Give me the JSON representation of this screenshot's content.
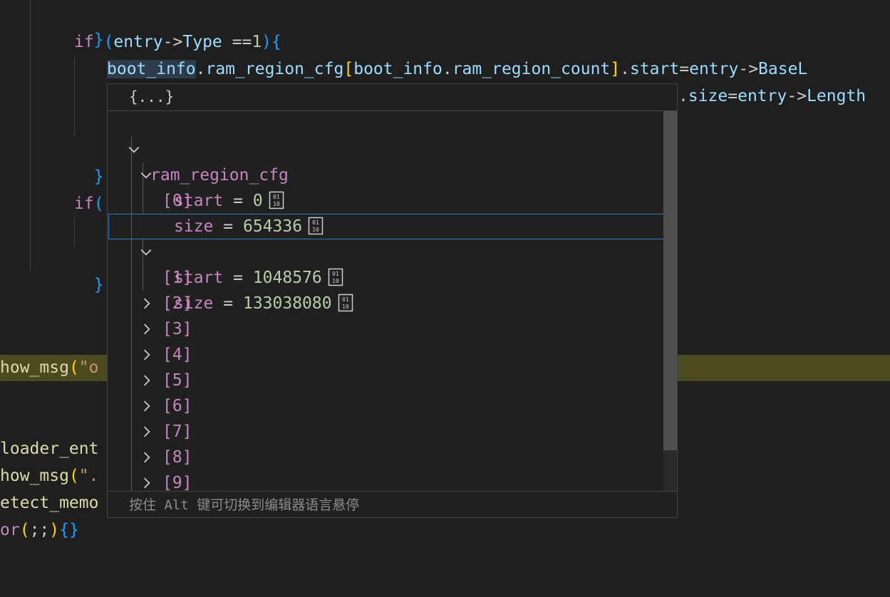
{
  "editor": {
    "lines": {
      "l1_brace": "}",
      "l2_if": "if",
      "l2_open": "(",
      "l2_entry": "entry",
      "l2_arrow": "->",
      "l2_type": "Type",
      "l2_eqeq": " ==",
      "l2_one": "1",
      "l2_close": ")",
      "l2_brace": "{",
      "l3_boot": "boot_info",
      "l3_dot": ".",
      "l3_ram": "ram_region_cfg",
      "l3_lbr": "[",
      "l3_boot2": "boot_info",
      "l3_dot2": ".",
      "l3_count": "ram_region_count",
      "l3_rbr": "]",
      "l3_rest_dot": ".",
      "l3_start": "start",
      "l3_eq": "=",
      "l3_entry": "entry",
      "l3_arrow": "->",
      "l3_base": "BaseL",
      "l4_dot": ".",
      "l4_size": "size",
      "l4_eq": "=",
      "l4_entry": "entry",
      "l4_arrow": "->",
      "l4_length": "Length",
      "l6_brace": "}",
      "l8_if": "if",
      "l8_paren": "(",
      "l10_brace": "}",
      "l14_fn": "how_msg",
      "l14_paren": "(",
      "l14_str": "\"o",
      "l17_fn": "loader_ent",
      "l18_fn": "how_msg",
      "l18_paren": "(",
      "l18_str": "\".",
      "l19_fn": "etect_memo",
      "l20_kw": "or",
      "l20_paren": "(",
      "l20_semi": ";;",
      "l20_paren2": ")",
      "l20_braces": "{}"
    }
  },
  "hover": {
    "title": "{...}",
    "tree": {
      "root_label": "ram_region_cfg",
      "item0_label": "[0]",
      "item0_start_name": "start",
      "item0_start_value": "0",
      "item0_size_name": "size",
      "item0_size_value": "654336",
      "item1_label": "[1]",
      "item1_start_name": "start",
      "item1_start_value": "1048576",
      "item1_size_name": "size",
      "item1_size_value": "133038080",
      "collapsed": [
        "[2]",
        "[3]",
        "[4]",
        "[5]",
        "[6]",
        "[7]",
        "[8]",
        "[9]"
      ],
      "equals": "="
    },
    "footer": "按住 Alt 键可切换到编辑器语言悬停"
  },
  "icons": {
    "expanded": "chevron-down-icon",
    "collapsed": "chevron-right-icon",
    "binary": "binary-view-icon"
  },
  "colors": {
    "background": "#1f1f1f",
    "keyword": "#c586c0",
    "variable": "#9cdcfe",
    "number": "#b5cea8",
    "function": "#dcdcaa",
    "string": "#ce9178",
    "debug_line": "#4b4b1f",
    "focus_border": "#2b79c2"
  }
}
